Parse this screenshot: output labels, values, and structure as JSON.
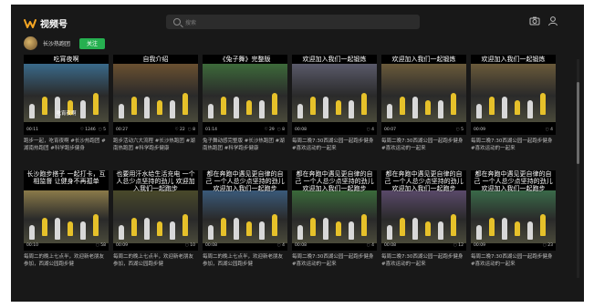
{
  "header": {
    "logo_icon": "channels-logo-icon",
    "logo_text": "视频号",
    "search_placeholder": "搜索",
    "icons": [
      "search-icon",
      "camera-icon",
      "user-icon"
    ]
  },
  "channel": {
    "name": "长沙热跑团",
    "follow_label": "关注",
    "follow_color": "#26b050"
  },
  "videos": [
    {
      "caption": "吃宵夜啊",
      "sub": "吃宵夜啊",
      "duration": "00:11",
      "likes": "1246",
      "comments": "5",
      "desc": "跑步一起，吃宵夜啊 #长沙热跑团 #湖南热跑团 #科学跑步健身",
      "palette": "#3a6a8a"
    },
    {
      "caption": "自我介绍",
      "sub": "",
      "duration": "00:27",
      "likes": "22",
      "comments": "8",
      "desc": "跑步活动六大流程 #长沙热跑团 #湖南热跑团 #科学跑步健康",
      "palette": "#6a5030"
    },
    {
      "caption": "《兔子舞》完整版",
      "sub": "",
      "duration": "01:14",
      "likes": "29",
      "comments": "8",
      "desc": "兔子舞动感完整版 #长沙热跑团 #湖南热跑团 #科学跑步健康",
      "palette": "#3d6a3a"
    },
    {
      "caption": "欢迎加入我们一起锻炼",
      "sub": "",
      "duration": "00:08",
      "likes": "",
      "comments": "4",
      "desc": "每周二晚7:30西湖公园一起跑步健身 #喜欢运动的一起来",
      "palette": "#5a5a6a"
    },
    {
      "caption": "欢迎加入我们一起锻炼",
      "sub": "",
      "duration": "00:07",
      "likes": "",
      "comments": "5",
      "desc": "每周二晚7:30西湖公园一起跑步健身 #喜欢运动的一起来",
      "palette": "#6a5a3a"
    },
    {
      "caption": "欢迎加入我们一起锻炼",
      "sub": "",
      "duration": "00:09",
      "likes": "",
      "comments": "4",
      "desc": "每周二晚7:30西湖公园一起跑步健身 #喜欢运动的一起来",
      "palette": "#6a5a3a"
    },
    {
      "caption": "长沙跑步搭子 一起打卡，互相监督 让健身不再孤单",
      "sub": "",
      "duration": "00:10",
      "likes": "",
      "comments": "58",
      "desc": "每周二的晚上七点半，欢迎新老朋友参加，西湖公园跑步健",
      "palette": "#8a7a4a"
    },
    {
      "caption": "也要用汗水给生活充电 一个人总少点坚持的劲儿 欢迎加入我们一起跑步",
      "sub": "",
      "duration": "00:09",
      "likes": "",
      "comments": "10",
      "desc": "每周二的晚上七点半，欢迎新老朋友参加，西湖公园跑步健",
      "palette": "#4a4a2a"
    },
    {
      "caption": "都在奔跑中遇见更自律的自己 一个人总少点坚持的劲儿 欢迎加入我们一起跑步",
      "sub": "",
      "duration": "00:08",
      "likes": "",
      "comments": "4",
      "desc": "每周二的晚上七点半，欢迎新老朋友参加，西湖公园跑步健",
      "palette": "#3a5a7a"
    },
    {
      "caption": "都在奔跑中遇见更自律的自己 一个人总少点坚持的劲儿 欢迎加入我们一起跑步",
      "sub": "",
      "duration": "00:08",
      "likes": "",
      "comments": "4",
      "desc": "每周二晚7:30西湖公园一起跑步健身 #喜欢运动的一起来",
      "palette": "#3a6a3a"
    },
    {
      "caption": "都在奔跑中遇见更自律的自己 一个人总少点坚持的劲儿 欢迎加入我们一起跑步",
      "sub": "",
      "duration": "00:08",
      "likes": "",
      "comments": "12",
      "desc": "每周二晚7:30西湖公园一起跑步健身 #喜欢运动的一起来",
      "palette": "#5a4a6a"
    },
    {
      "caption": "都在奔跑中遇见更自律的自己 一个人总少点坚持的劲儿 欢迎加入我们一起跑步",
      "sub": "",
      "duration": "00:09",
      "likes": "",
      "comments": "23",
      "desc": "每周二晚7:30西湖公园一起跑步健身 #喜欢运动的一起来",
      "palette": "#3a6a4a"
    }
  ]
}
